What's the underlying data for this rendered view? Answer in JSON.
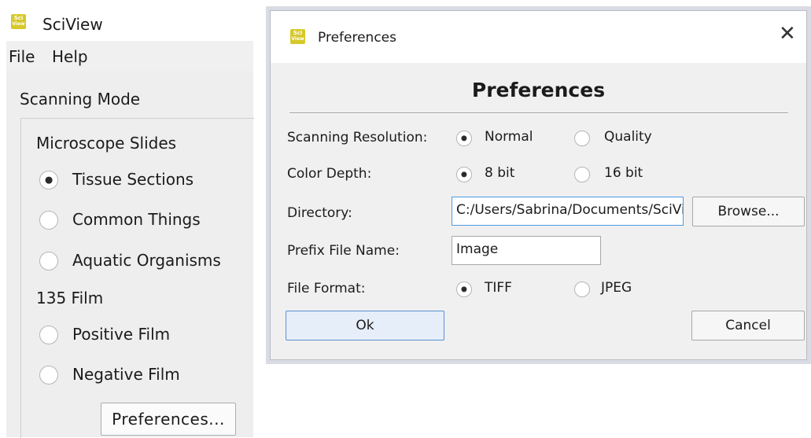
{
  "main_window": {
    "title": "SciView",
    "logo_text_top": "Sci",
    "logo_text_bottom": "View",
    "menu": [
      "File",
      "Help"
    ],
    "group_title": "Scanning Mode",
    "microscope_label": "Microscope Slides",
    "microscope_options": [
      {
        "label": "Tissue Sections",
        "checked": true
      },
      {
        "label": "Common Things",
        "checked": false
      },
      {
        "label": "Aquatic Organisms",
        "checked": false
      }
    ],
    "film_label": "135 Film",
    "film_options": [
      {
        "label": "Positive Film",
        "checked": false
      },
      {
        "label": "Negative Film",
        "checked": false
      }
    ],
    "preferences_button": "Preferences..."
  },
  "dialog": {
    "title": "Preferences",
    "close_glyph": "✕",
    "heading": "Preferences",
    "scanning_resolution": {
      "label": "Scanning Resolution:",
      "options": [
        {
          "label": "Normal",
          "checked": true
        },
        {
          "label": "Quality",
          "checked": false
        }
      ]
    },
    "color_depth": {
      "label": "Color Depth:",
      "options": [
        {
          "label": "8 bit",
          "checked": true
        },
        {
          "label": "16 bit",
          "checked": false
        }
      ]
    },
    "directory": {
      "label": "Directory:",
      "value": "C:/Users/Sabrina/Documents/SciView",
      "browse_button": "Browse..."
    },
    "prefix": {
      "label": "Prefix File Name:",
      "value": "Image"
    },
    "file_format": {
      "label": "File Format:",
      "options": [
        {
          "label": "TIFF",
          "checked": true
        },
        {
          "label": "JPEG",
          "checked": false
        }
      ]
    },
    "ok_button": "Ok",
    "cancel_button": "Cancel"
  },
  "colors": {
    "logo": "#d6c82a",
    "focus_border": "#4b9be0",
    "default_button_border": "#5a92d4"
  }
}
